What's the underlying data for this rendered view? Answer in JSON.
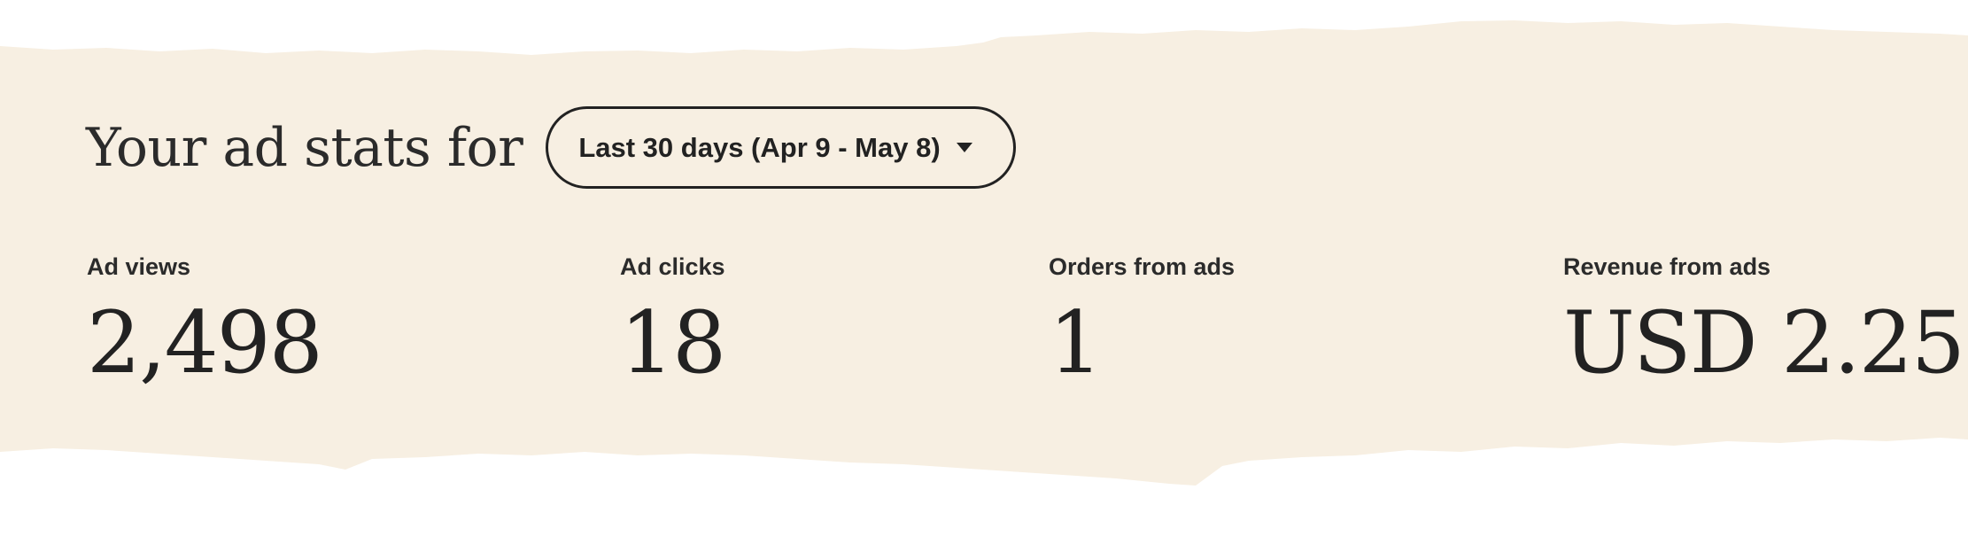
{
  "header": {
    "title": "Your ad stats for",
    "date_range": {
      "label": "Last 30 days (Apr 9 - May 8)",
      "icon": "caret-down-icon"
    }
  },
  "stats": [
    {
      "label": "Ad views",
      "value": "2,498"
    },
    {
      "label": "Ad clicks",
      "value": "18"
    },
    {
      "label": "Orders from ads",
      "value": "1"
    },
    {
      "label": "Revenue from ads",
      "value": "USD 2.25"
    }
  ],
  "colors": {
    "paper": "#f7efe2",
    "text": "#222222"
  }
}
